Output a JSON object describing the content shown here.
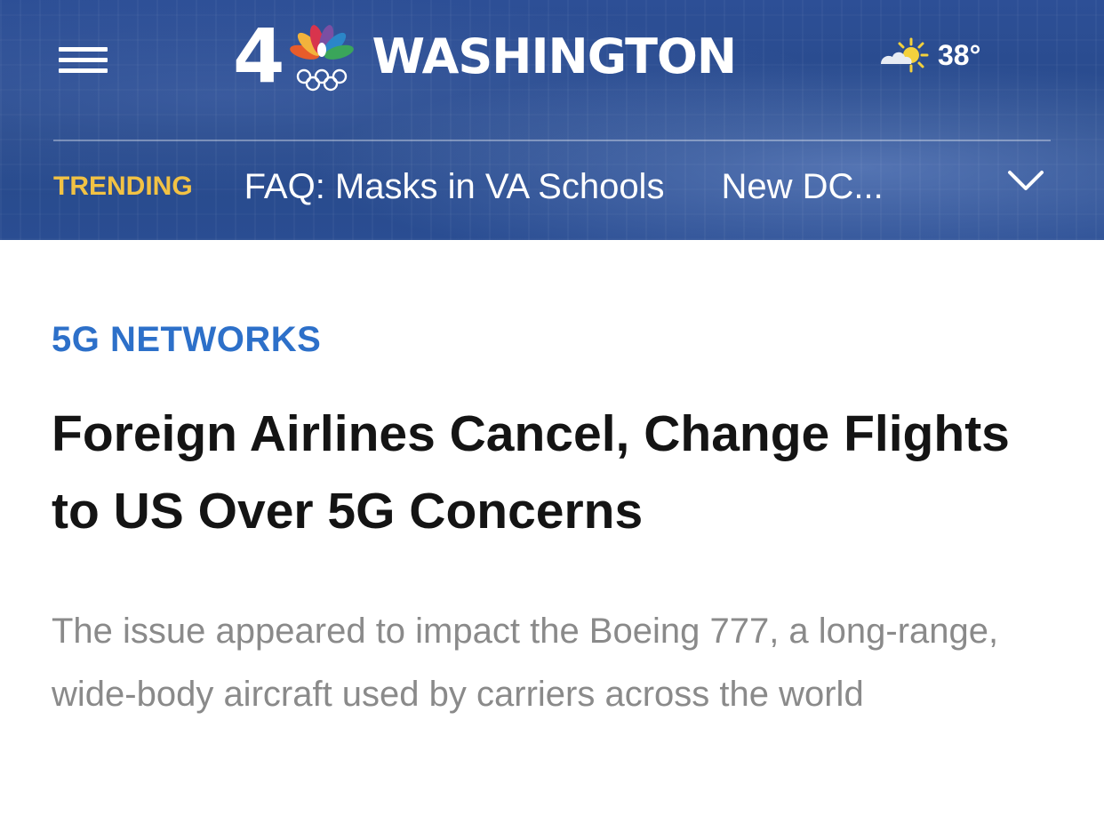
{
  "header": {
    "logo": {
      "channel_number": "4",
      "station_name": "WASHINGTON",
      "peacock_icon": "nbc-peacock-olympic-rings-icon"
    },
    "menu_icon": "hamburger-menu-icon",
    "weather": {
      "icon": "partly-sunny-icon",
      "temperature": "38°"
    },
    "trending": {
      "label": "TRENDING",
      "links": [
        "FAQ: Masks in VA Schools",
        "New DC..."
      ],
      "expand_icon": "chevron-down-icon"
    },
    "colors": {
      "background": "#2a4b8e",
      "trending_label": "#f2c244"
    }
  },
  "article": {
    "kicker": "5G NETWORKS",
    "headline": "Foreign Airlines Cancel, Change Flights to US Over 5G Concerns",
    "summary": "The issue appeared to impact the Boeing 777, a long-range, wide-body aircraft used by carriers across the world",
    "colors": {
      "kicker": "#2d70c9",
      "headline": "#141414",
      "summary": "#8a8a8a"
    }
  }
}
